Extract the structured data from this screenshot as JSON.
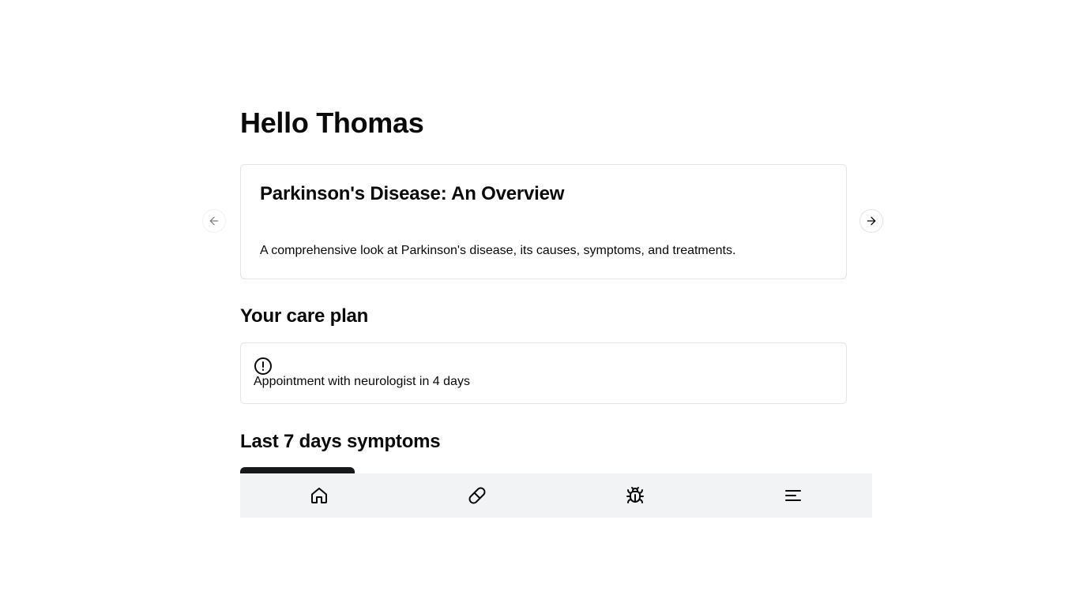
{
  "greeting": "Hello Thomas",
  "carousel": {
    "card": {
      "title": "Parkinson's Disease: An Overview",
      "description": "A comprehensive look at Parkinson's disease, its causes, symptoms, and treatments."
    },
    "prev_icon": "arrow-left-icon",
    "next_icon": "arrow-right-icon"
  },
  "care_plan": {
    "heading": "Your care plan",
    "items": [
      {
        "icon": "alert-circle-icon",
        "text": "Appointment with neurologist in 4 days"
      }
    ]
  },
  "symptoms": {
    "heading": "Last 7 days symptoms"
  },
  "bottom_nav": {
    "items": [
      {
        "icon": "home-icon"
      },
      {
        "icon": "pill-icon"
      },
      {
        "icon": "bug-icon"
      },
      {
        "icon": "menu-icon"
      }
    ]
  }
}
